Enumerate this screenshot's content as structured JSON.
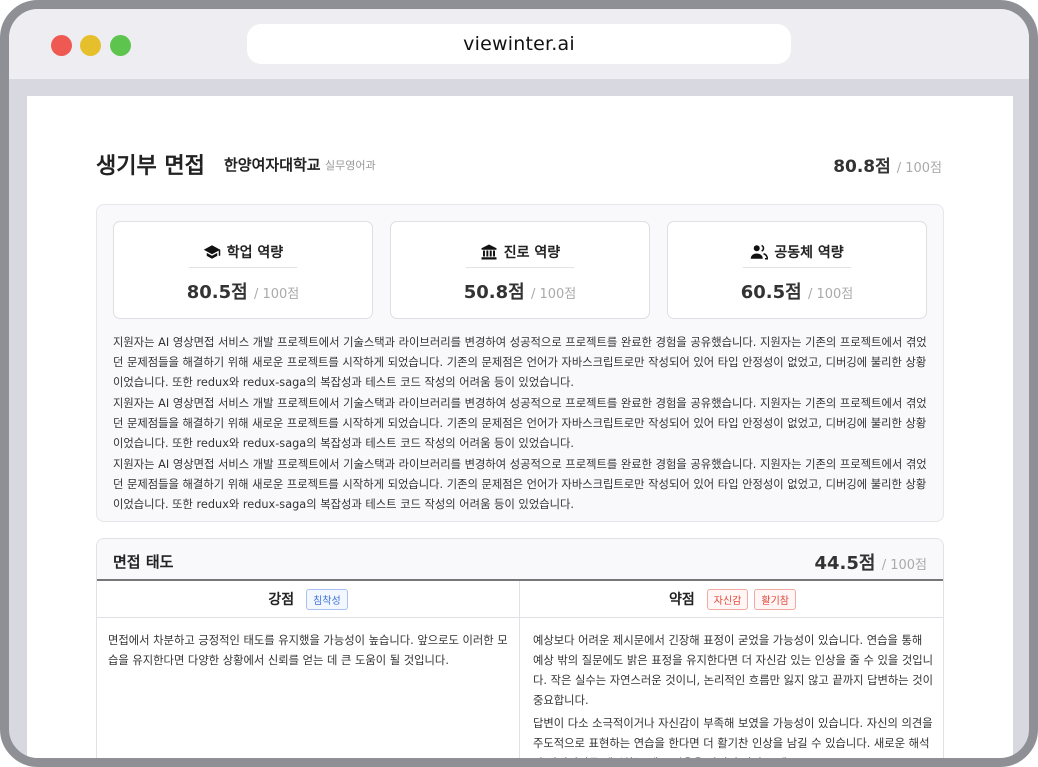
{
  "browser": {
    "url": "viewinter.ai"
  },
  "header": {
    "title": "생기부 면접",
    "school": "한양여자대학교",
    "department": "실무영어과",
    "score": "80.8점",
    "score_max": "/ 100점"
  },
  "categories": [
    {
      "icon": "graduation-cap-icon",
      "label": "학업 역량",
      "score": "80.5점",
      "max": "/ 100점"
    },
    {
      "icon": "institution-icon",
      "label": "진로 역량",
      "score": "50.8점",
      "max": "/ 100점"
    },
    {
      "icon": "people-icon",
      "label": "공동체 역량",
      "score": "60.5점",
      "max": "/ 100점"
    }
  ],
  "description": [
    "지원자는 AI 영상면접 서비스 개발 프로젝트에서 기술스택과 라이브러리를 변경하여 성공적으로 프로젝트를 완료한 경험을 공유했습니다. 지원자는 기존의 프로젝트에서 겪었던 문제점들을 해결하기 위해 새로운 프로젝트를 시작하게 되었습니다. 기존의 문제점은 언어가 자바스크립트로만 작성되어 있어 타입 안정성이 없었고, 디버깅에 불리한 상황이었습니다. 또한 redux와 redux-saga의 복잡성과 테스트 코드 작성의 어려움 등이 있었습니다.",
    "지원자는 AI 영상면접 서비스 개발 프로젝트에서 기술스택과 라이브러리를 변경하여 성공적으로 프로젝트를 완료한 경험을 공유했습니다. 지원자는 기존의 프로젝트에서 겪었던 문제점들을 해결하기 위해 새로운 프로젝트를 시작하게 되었습니다. 기존의 문제점은 언어가 자바스크립트로만 작성되어 있어 타입 안정성이 없었고, 디버깅에 불리한 상황이었습니다. 또한 redux와 redux-saga의 복잡성과 테스트 코드 작성의 어려움 등이 있었습니다.",
    "지원자는 AI 영상면접 서비스 개발 프로젝트에서 기술스택과 라이브러리를 변경하여 성공적으로 프로젝트를 완료한 경험을 공유했습니다. 지원자는 기존의 프로젝트에서 겪었던 문제점들을 해결하기 위해 새로운 프로젝트를 시작하게 되었습니다. 기존의 문제점은 언어가 자바스크립트로만 작성되어 있어 타입 안정성이 없었고, 디버깅에 불리한 상황이었습니다. 또한 redux와 redux-saga의 복잡성과 테스트 코드 작성의 어려움 등이 있었습니다."
  ],
  "attitude": {
    "title": "면접 태도",
    "score": "44.5점",
    "score_max": "/ 100점",
    "strengths": {
      "label": "강점",
      "tags": [
        "침착성"
      ],
      "paragraphs": [
        "면접에서 차분하고 긍정적인 태도를 유지했을 가능성이 높습니다. 앞으로도 이러한 모습을 유지한다면 다양한 상황에서 신뢰를 얻는 데 큰 도움이 될 것입니다."
      ]
    },
    "weaknesses": {
      "label": "약점",
      "tags": [
        "자신감",
        "활기참"
      ],
      "paragraphs": [
        "예상보다 어려운 제시문에서 긴장해 표정이 굳었을 가능성이 있습니다. 연습을 통해 예상 밖의 질문에도 밝은 표정을 유지한다면 더 자신감 있는 인상을 줄 수 있을 것입니다. 작은 실수는 자연스러운 것이니, 논리적인 흐름만 잃지 않고 끝까지 답변하는 것이 중요합니다.",
        "답변이 다소 소극적이거나 자신감이 부족해 보였을 가능성이 있습니다. 자신의 의견을 주도적으로 표현하는 연습을 한다면 더 활기찬 인상을 남길 수 있습니다. 새로운 해석과 아이디어를 제시하는 데 두려움을 가지지 말아 보세요."
      ]
    }
  },
  "colors": {
    "accent_blue": "#3b73d9",
    "accent_red": "#e04a3c",
    "frame_border": "#8f8f96"
  }
}
